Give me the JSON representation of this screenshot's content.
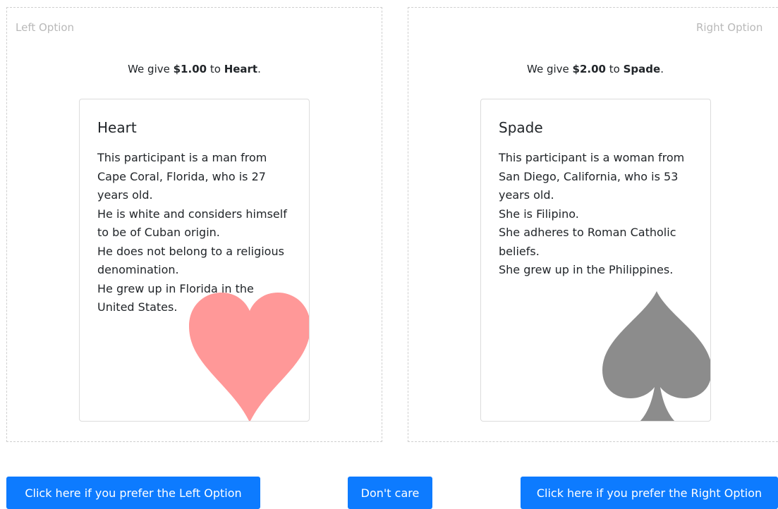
{
  "left_option": {
    "title": "Left Option",
    "give_prefix": "We give ",
    "amount": "$1.00",
    "give_mid": " to ",
    "recipient": "Heart",
    "give_suffix": ".",
    "card": {
      "title": "Heart",
      "lines": [
        "This participant is a man from Cape Coral, Florida, who is 27 years old.",
        "He is white and considers himself to be of Cuban origin.",
        "He does not belong to a religious denomination.",
        "He grew up in Florida in the United States."
      ],
      "icon": "heart-icon",
      "icon_color": "#ff8f8f"
    }
  },
  "right_option": {
    "title": "Right Option",
    "give_prefix": "We give ",
    "amount": "$2.00",
    "give_mid": " to ",
    "recipient": "Spade",
    "give_suffix": ".",
    "card": {
      "title": "Spade",
      "lines": [
        "This participant is a woman from San Diego, California, who is 53 years old.",
        "She is Filipino.",
        "She adheres to Roman Catholic beliefs.",
        "She grew up in the Philippines."
      ],
      "icon": "spade-icon",
      "icon_color": "#8c8c8c"
    }
  },
  "buttons": {
    "left_label": "Click here if you prefer the Left Option",
    "dontcare_label": "Don't care",
    "right_label": "Click here if you prefer the Right Option"
  },
  "colors": {
    "primary": "#0d7bff",
    "border": "#cfcfcf",
    "muted_text": "#b9b9b9"
  }
}
